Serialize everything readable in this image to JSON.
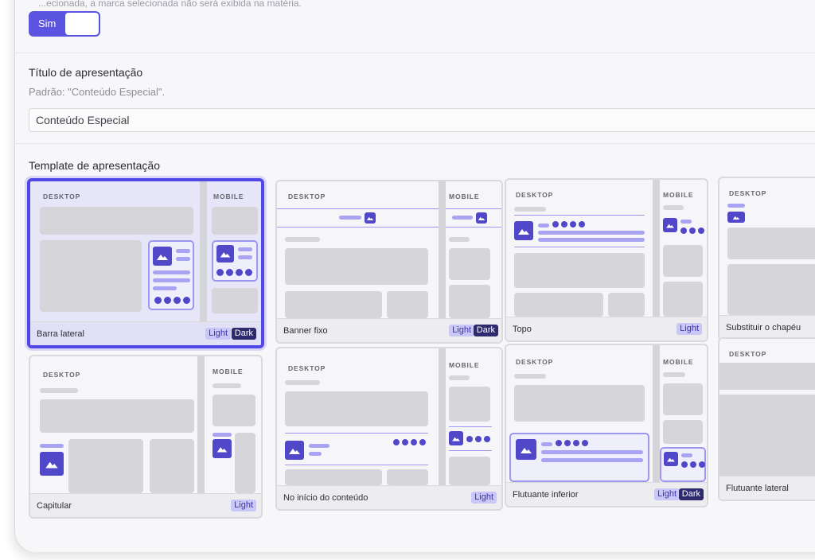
{
  "top_hint": "...ecionada, a marca selecionada não será exibida na matéria.",
  "toggle": {
    "label": "Sim",
    "state": "on"
  },
  "title_field": {
    "label": "Título de apresentação",
    "help": "Padrão: \"Conteúdo Especial\".",
    "value": "Conteúdo Especial"
  },
  "template_section": {
    "label": "Template de apresentação"
  },
  "captions": {
    "desktop": "DESKTOP",
    "mobile": "MOBILE"
  },
  "colors": {
    "accent": "#5147e6",
    "icon_fill": "#5147c9",
    "tag_light": "#c9c6f8",
    "tag_dark": "#2d2a6e"
  },
  "templates": [
    {
      "name": "Barra lateral",
      "light": "Light",
      "dark": "Dark",
      "selected": true
    },
    {
      "name": "Banner fixo",
      "light": "Light",
      "dark": "Dark",
      "selected": false
    },
    {
      "name": "Topo",
      "light": "Light",
      "selected": false
    },
    {
      "name": "Substituir o chapéu",
      "selected": false
    },
    {
      "name": "Capitular",
      "light": "Light",
      "selected": false
    },
    {
      "name": "No início do conteúdo",
      "light": "Light",
      "selected": false
    },
    {
      "name": "Flutuante inferior",
      "light": "Light",
      "dark": "Dark",
      "selected": false
    },
    {
      "name": "Flutuante lateral",
      "selected": false
    }
  ]
}
